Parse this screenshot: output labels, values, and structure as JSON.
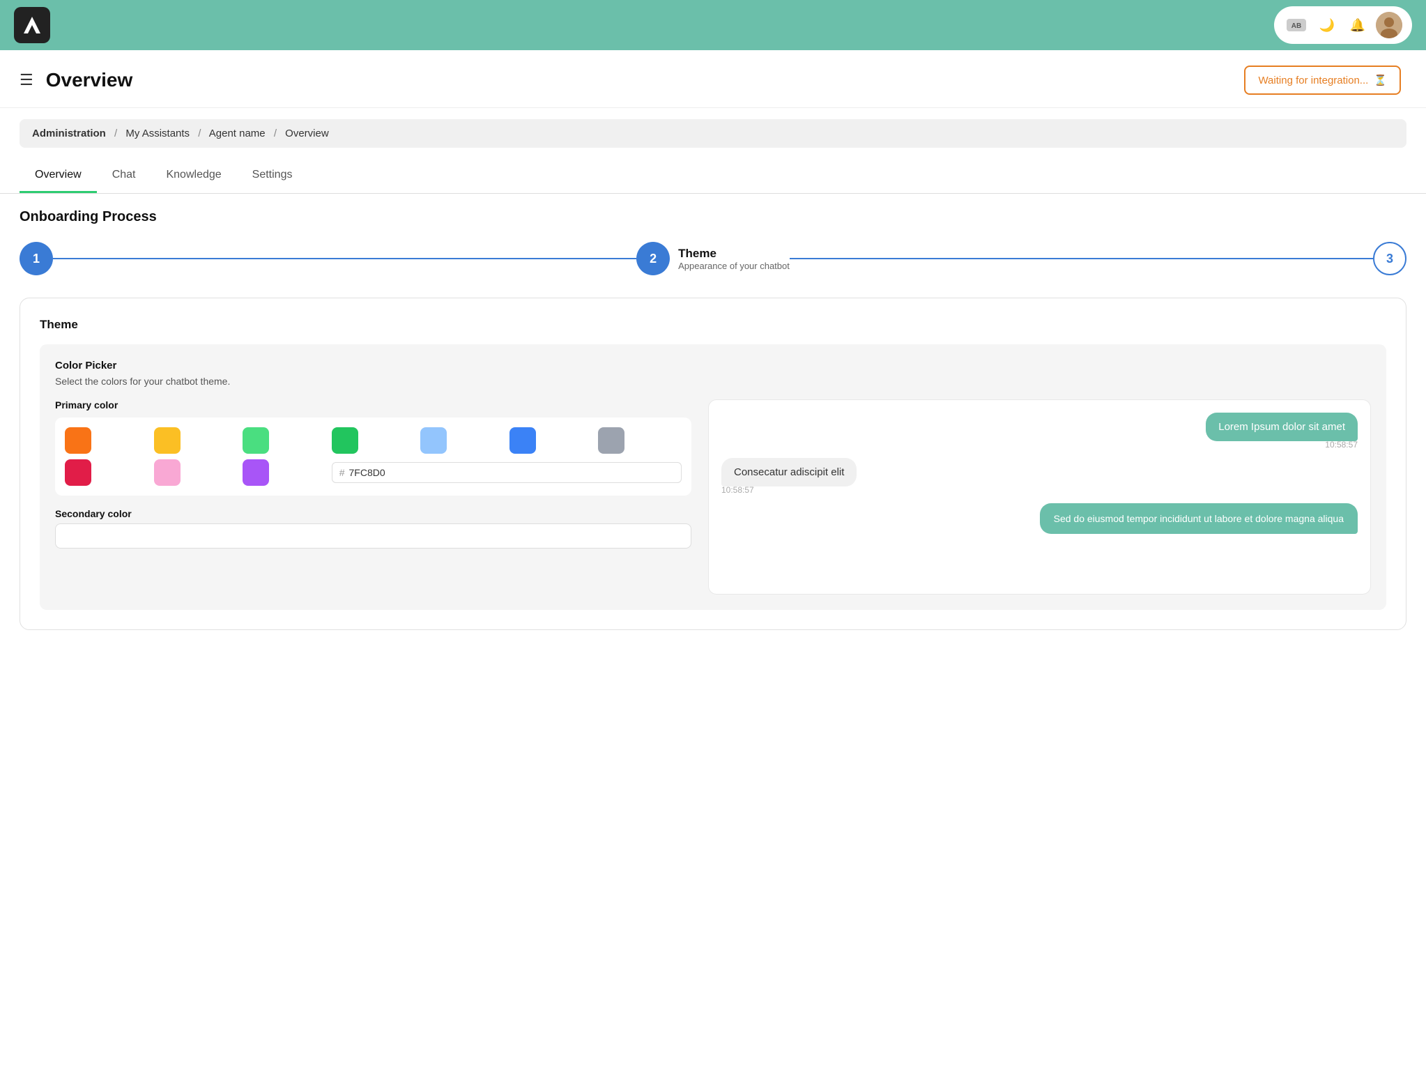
{
  "topnav": {
    "logo_alt": "A",
    "icons": [
      "AB",
      "🌙",
      "🔔"
    ],
    "avatar_letter": "👤"
  },
  "header": {
    "title": "Overview",
    "waiting_btn": "Waiting for integration...",
    "waiting_icon": "⏳"
  },
  "breadcrumb": {
    "parts": [
      "Administration",
      "My Assistants",
      "Agent name",
      "Overview"
    ],
    "separators": [
      "/",
      "/",
      "/"
    ]
  },
  "tabs": [
    {
      "label": "Overview",
      "active": true
    },
    {
      "label": "Chat",
      "active": false
    },
    {
      "label": "Knowledge",
      "active": false
    },
    {
      "label": "Settings",
      "active": false
    }
  ],
  "onboarding": {
    "section_title": "Onboarding Process",
    "steps": [
      {
        "number": "1",
        "outline": false,
        "label": "",
        "sub": ""
      },
      {
        "number": "2",
        "outline": false,
        "label": "Theme",
        "sub": "Appearance of your chatbot"
      },
      {
        "number": "3",
        "outline": true,
        "label": "",
        "sub": ""
      }
    ]
  },
  "theme": {
    "card_title": "Theme",
    "color_picker_title": "Color Picker",
    "color_picker_subtitle": "Select the colors for your chatbot theme.",
    "primary_color_label": "Primary color",
    "secondary_color_label": "Secondary color",
    "swatches": [
      "#F97316",
      "#FBBF24",
      "#4ADE80",
      "#22C55E",
      "#93C5FD",
      "#3B82F6",
      "#9CA3AF",
      "#E11D48",
      "#F9A8D4",
      "#A855F7"
    ],
    "hex_symbol": "#",
    "hex_value": "7FC8D0",
    "chat_preview": {
      "msg1": "Lorem Ipsum dolor sit amet",
      "time1": "10:58:57",
      "msg2": "Consecatur adiscipit elit",
      "time2": "10:58:57",
      "msg3": "Sed do eiusmod tempor incididunt ut labore et dolore magna aliqua",
      "primary_color": "#6bbfaa"
    }
  }
}
